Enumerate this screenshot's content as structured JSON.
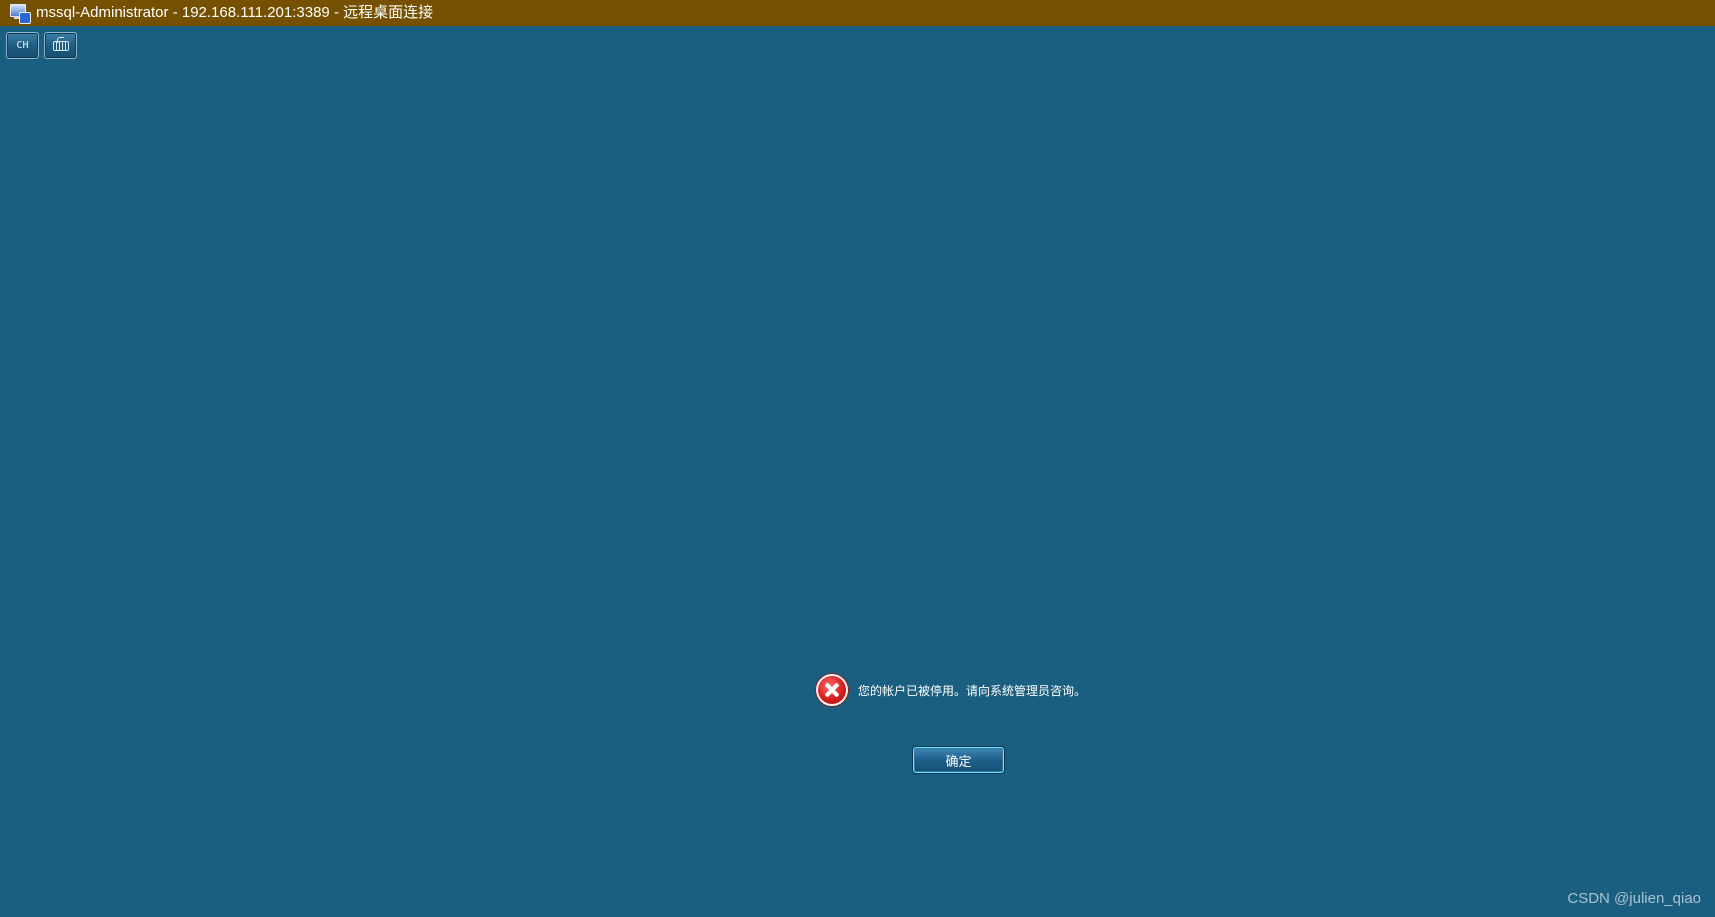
{
  "window": {
    "title": "mssql-Administrator - 192.168.111.201:3389 - 远程桌面连接",
    "icon": "remote-desktop-icon"
  },
  "language_bar": {
    "language_label": "CH",
    "keyboard_icon": "keyboard-icon"
  },
  "dialog": {
    "icon": "error-icon",
    "message": "您的帐户已被停用。请向系统管理员咨询。",
    "ok_label": "确定"
  },
  "watermark": "CSDN @julien_qiao",
  "colors": {
    "titlebar": "#745000",
    "desktop": "#1b5f80"
  }
}
